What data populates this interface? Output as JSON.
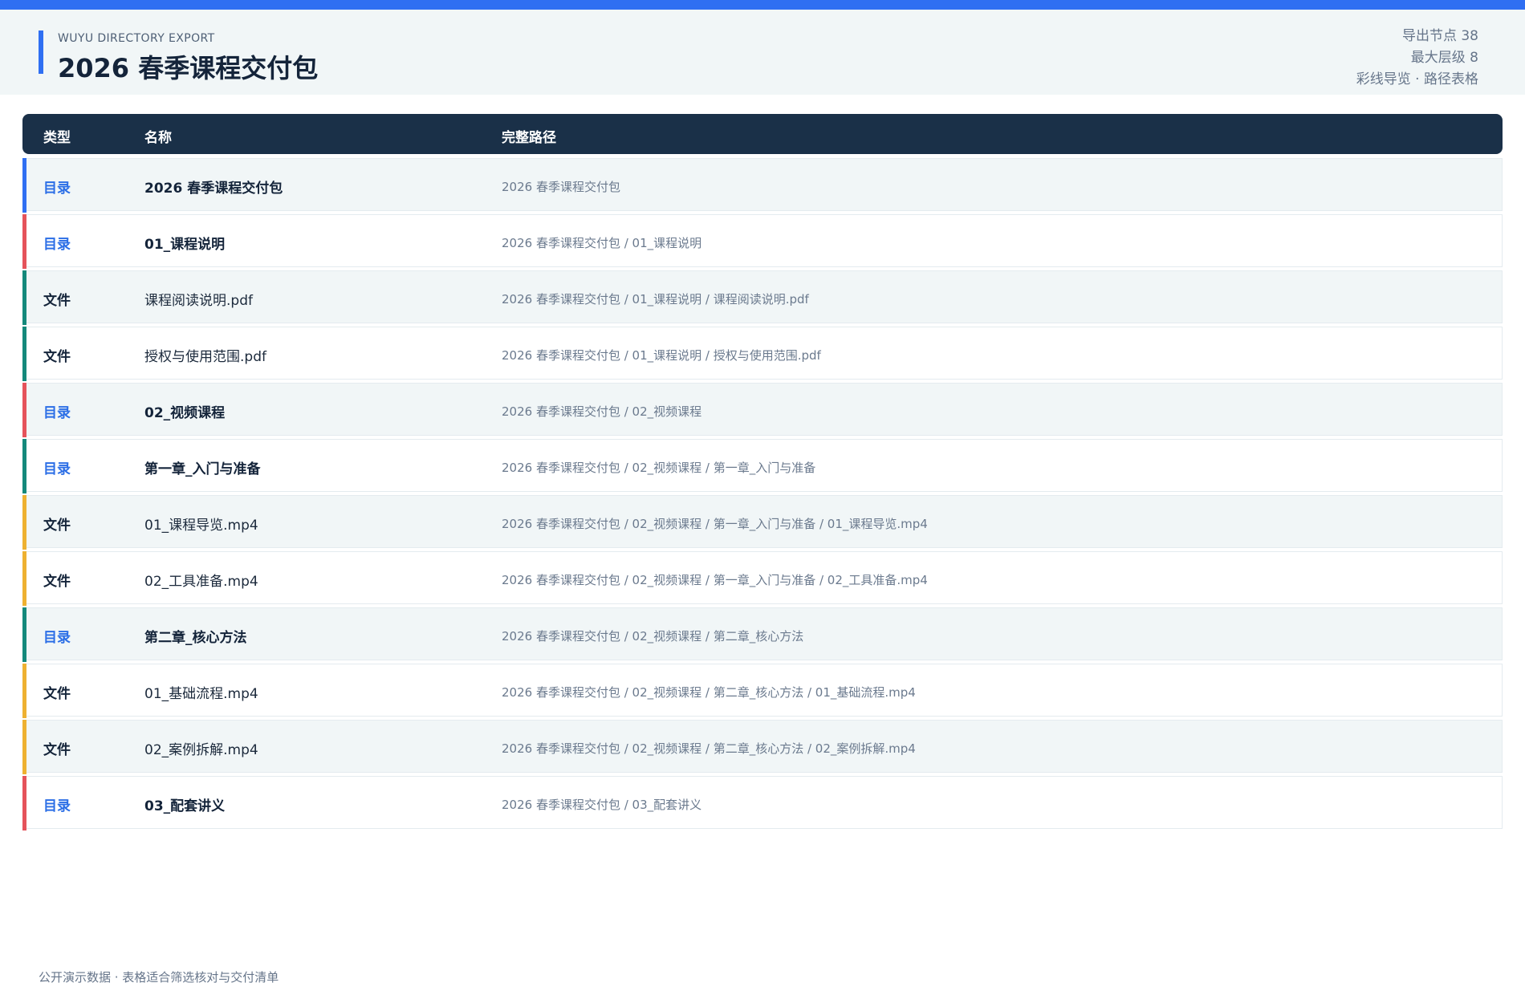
{
  "header": {
    "kicker": "WUYU DIRECTORY EXPORT",
    "title": "2026 春季课程交付包",
    "meta": [
      "导出节点 38",
      "最大层级 8",
      "彩线导览 · 路径表格"
    ]
  },
  "colors": {
    "accent": "#2f6ff2",
    "header_dark": "#1a3048",
    "stripe_blue": "#2f6ff2",
    "stripe_red": "#e5535b",
    "stripe_teal": "#14897b",
    "stripe_amber": "#eeb131"
  },
  "table": {
    "columns": [
      "类型",
      "名称",
      "完整路径"
    ],
    "rows": [
      {
        "type": "目录",
        "kind": "dir",
        "stripe": "blue",
        "name": "2026 春季课程交付包",
        "path": "2026 春季课程交付包"
      },
      {
        "type": "目录",
        "kind": "dir",
        "stripe": "red",
        "name": "01_课程说明",
        "path": "2026 春季课程交付包 / 01_课程说明"
      },
      {
        "type": "文件",
        "kind": "file",
        "stripe": "teal",
        "name": "课程阅读说明.pdf",
        "path": "2026 春季课程交付包 / 01_课程说明 / 课程阅读说明.pdf"
      },
      {
        "type": "文件",
        "kind": "file",
        "stripe": "teal",
        "name": "授权与使用范围.pdf",
        "path": "2026 春季课程交付包 / 01_课程说明 / 授权与使用范围.pdf"
      },
      {
        "type": "目录",
        "kind": "dir",
        "stripe": "red",
        "name": "02_视频课程",
        "path": "2026 春季课程交付包 / 02_视频课程"
      },
      {
        "type": "目录",
        "kind": "dir",
        "stripe": "teal",
        "name": "第一章_入门与准备",
        "path": "2026 春季课程交付包 / 02_视频课程 / 第一章_入门与准备"
      },
      {
        "type": "文件",
        "kind": "file",
        "stripe": "amber",
        "name": "01_课程导览.mp4",
        "path": "2026 春季课程交付包 / 02_视频课程 / 第一章_入门与准备 / 01_课程导览.mp4"
      },
      {
        "type": "文件",
        "kind": "file",
        "stripe": "amber",
        "name": "02_工具准备.mp4",
        "path": "2026 春季课程交付包 / 02_视频课程 / 第一章_入门与准备 / 02_工具准备.mp4"
      },
      {
        "type": "目录",
        "kind": "dir",
        "stripe": "teal",
        "name": "第二章_核心方法",
        "path": "2026 春季课程交付包 / 02_视频课程 / 第二章_核心方法"
      },
      {
        "type": "文件",
        "kind": "file",
        "stripe": "amber",
        "name": "01_基础流程.mp4",
        "path": "2026 春季课程交付包 / 02_视频课程 / 第二章_核心方法 / 01_基础流程.mp4"
      },
      {
        "type": "文件",
        "kind": "file",
        "stripe": "amber",
        "name": "02_案例拆解.mp4",
        "path": "2026 春季课程交付包 / 02_视频课程 / 第二章_核心方法 / 02_案例拆解.mp4"
      },
      {
        "type": "目录",
        "kind": "dir",
        "stripe": "red",
        "name": "03_配套讲义",
        "path": "2026 春季课程交付包 / 03_配套讲义"
      }
    ]
  },
  "footer": "公开演示数据 · 表格适合筛选核对与交付清单"
}
